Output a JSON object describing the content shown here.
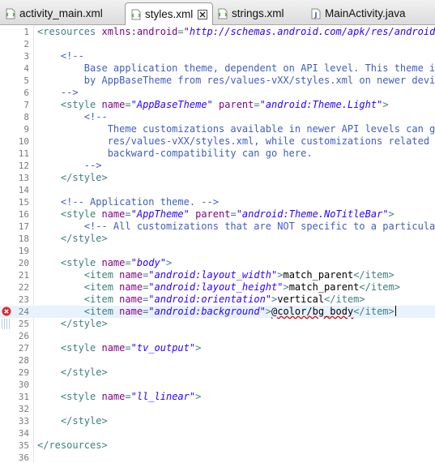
{
  "tabs": [
    {
      "label": "activity_main.xml",
      "icon": "xml-file-icon",
      "active": false
    },
    {
      "label": "styles.xml",
      "icon": "xml-file-icon",
      "active": true
    },
    {
      "label": "strings.xml",
      "icon": "xml-file-icon",
      "active": false
    },
    {
      "label": "MainActivity.java",
      "icon": "java-file-icon",
      "active": false
    }
  ],
  "editor": {
    "current_line": 24,
    "error_line": 24,
    "lines": [
      {
        "n": "1",
        "tokens": [
          [
            "tag",
            "<resources "
          ],
          [
            "attr",
            "xmlns:android"
          ],
          [
            "tag",
            "="
          ],
          [
            "val",
            "\"http://schemas.android.com/apk/res/android\""
          ],
          [
            "tag",
            ">"
          ]
        ]
      },
      {
        "n": "2",
        "tokens": []
      },
      {
        "n": "3",
        "tokens": [
          [
            "com",
            "    <!--"
          ]
        ]
      },
      {
        "n": "4",
        "tokens": [
          [
            "com",
            "        Base application theme, dependent on API level. This theme is"
          ]
        ]
      },
      {
        "n": "5",
        "tokens": [
          [
            "com",
            "        by AppBaseTheme from res/values-vXX/styles.xml on newer device"
          ]
        ]
      },
      {
        "n": "6",
        "tokens": [
          [
            "com",
            "    -->"
          ]
        ]
      },
      {
        "n": "7",
        "tokens": [
          [
            "tag",
            "    <style "
          ],
          [
            "attr",
            "name"
          ],
          [
            "tag",
            "="
          ],
          [
            "val",
            "\"AppBaseTheme\""
          ],
          [
            "txt",
            " "
          ],
          [
            "attr",
            "parent"
          ],
          [
            "tag",
            "="
          ],
          [
            "val",
            "\"android:Theme.Light\""
          ],
          [
            "tag",
            ">"
          ]
        ]
      },
      {
        "n": "8",
        "tokens": [
          [
            "com",
            "        <!--"
          ]
        ]
      },
      {
        "n": "9",
        "tokens": [
          [
            "com",
            "            Theme customizations available in newer API levels can go"
          ]
        ]
      },
      {
        "n": "10",
        "tokens": [
          [
            "com",
            "            res/values-vXX/styles.xml, while customizations related to"
          ]
        ]
      },
      {
        "n": "11",
        "tokens": [
          [
            "com",
            "            backward-compatibility can go here."
          ]
        ]
      },
      {
        "n": "12",
        "tokens": [
          [
            "com",
            "        -->"
          ]
        ]
      },
      {
        "n": "13",
        "tokens": [
          [
            "tag",
            "    </style>"
          ]
        ]
      },
      {
        "n": "14",
        "tokens": []
      },
      {
        "n": "15",
        "tokens": [
          [
            "com",
            "    <!-- Application theme. -->"
          ]
        ]
      },
      {
        "n": "16",
        "tokens": [
          [
            "tag",
            "    <style "
          ],
          [
            "attr",
            "name"
          ],
          [
            "tag",
            "="
          ],
          [
            "val",
            "\"AppTheme\""
          ],
          [
            "txt",
            " "
          ],
          [
            "attr",
            "parent"
          ],
          [
            "tag",
            "="
          ],
          [
            "val",
            "\"android:Theme.NoTitleBar\""
          ],
          [
            "tag",
            ">"
          ]
        ]
      },
      {
        "n": "17",
        "tokens": [
          [
            "com",
            "        <!-- All customizations that are NOT specific to a particular ."
          ]
        ]
      },
      {
        "n": "18",
        "tokens": [
          [
            "tag",
            "    </style>"
          ]
        ]
      },
      {
        "n": "19",
        "tokens": []
      },
      {
        "n": "20",
        "tokens": [
          [
            "tag",
            "    <style "
          ],
          [
            "attr",
            "name"
          ],
          [
            "tag",
            "="
          ],
          [
            "val",
            "\"body\""
          ],
          [
            "tag",
            ">"
          ]
        ]
      },
      {
        "n": "21",
        "tokens": [
          [
            "tag",
            "        <item "
          ],
          [
            "attr",
            "name"
          ],
          [
            "tag",
            "="
          ],
          [
            "val",
            "\"android:layout_width\""
          ],
          [
            "tag",
            ">"
          ],
          [
            "txt",
            "match_parent"
          ],
          [
            "tag",
            "</item>"
          ]
        ]
      },
      {
        "n": "22",
        "tokens": [
          [
            "tag",
            "        <item "
          ],
          [
            "attr",
            "name"
          ],
          [
            "tag",
            "="
          ],
          [
            "val",
            "\"android:layout_height\""
          ],
          [
            "tag",
            ">"
          ],
          [
            "txt",
            "match_parent"
          ],
          [
            "tag",
            "</item>"
          ]
        ]
      },
      {
        "n": "23",
        "tokens": [
          [
            "tag",
            "        <item "
          ],
          [
            "attr",
            "name"
          ],
          [
            "tag",
            "="
          ],
          [
            "val",
            "\"android:orientation\""
          ],
          [
            "tag",
            ">"
          ],
          [
            "txt",
            "vertical"
          ],
          [
            "tag",
            "</item>"
          ]
        ]
      },
      {
        "n": "24",
        "tokens": [
          [
            "tag",
            "        <item "
          ],
          [
            "attr",
            "name"
          ],
          [
            "tag",
            "="
          ],
          [
            "val",
            "\"android:background\""
          ],
          [
            "tag",
            ">"
          ],
          [
            "err",
            "@color/bg_body"
          ],
          [
            "tag",
            "</item>"
          ]
        ]
      },
      {
        "n": "25",
        "tokens": [
          [
            "tag",
            "    </style>"
          ]
        ]
      },
      {
        "n": "26",
        "tokens": []
      },
      {
        "n": "27",
        "tokens": [
          [
            "tag",
            "    <style "
          ],
          [
            "attr",
            "name"
          ],
          [
            "tag",
            "="
          ],
          [
            "val",
            "\"tv_output\""
          ],
          [
            "tag",
            ">"
          ]
        ]
      },
      {
        "n": "28",
        "tokens": []
      },
      {
        "n": "29",
        "tokens": [
          [
            "tag",
            "    </style>"
          ]
        ]
      },
      {
        "n": "30",
        "tokens": []
      },
      {
        "n": "31",
        "tokens": [
          [
            "tag",
            "    <style "
          ],
          [
            "attr",
            "name"
          ],
          [
            "tag",
            "="
          ],
          [
            "val",
            "\"ll_linear\""
          ],
          [
            "tag",
            ">"
          ]
        ]
      },
      {
        "n": "32",
        "tokens": []
      },
      {
        "n": "33",
        "tokens": [
          [
            "tag",
            "    </style>"
          ]
        ]
      },
      {
        "n": "34",
        "tokens": []
      },
      {
        "n": "35",
        "tokens": [
          [
            "tag",
            "</resources>"
          ]
        ]
      },
      {
        "n": "36",
        "tokens": []
      }
    ]
  },
  "colors": {
    "tag": "#3f7f7f",
    "attr": "#7f007f",
    "value": "#2a00ff",
    "comment": "#3f5fbf",
    "error": "#d40000",
    "current_line": "#e8f2fe"
  }
}
